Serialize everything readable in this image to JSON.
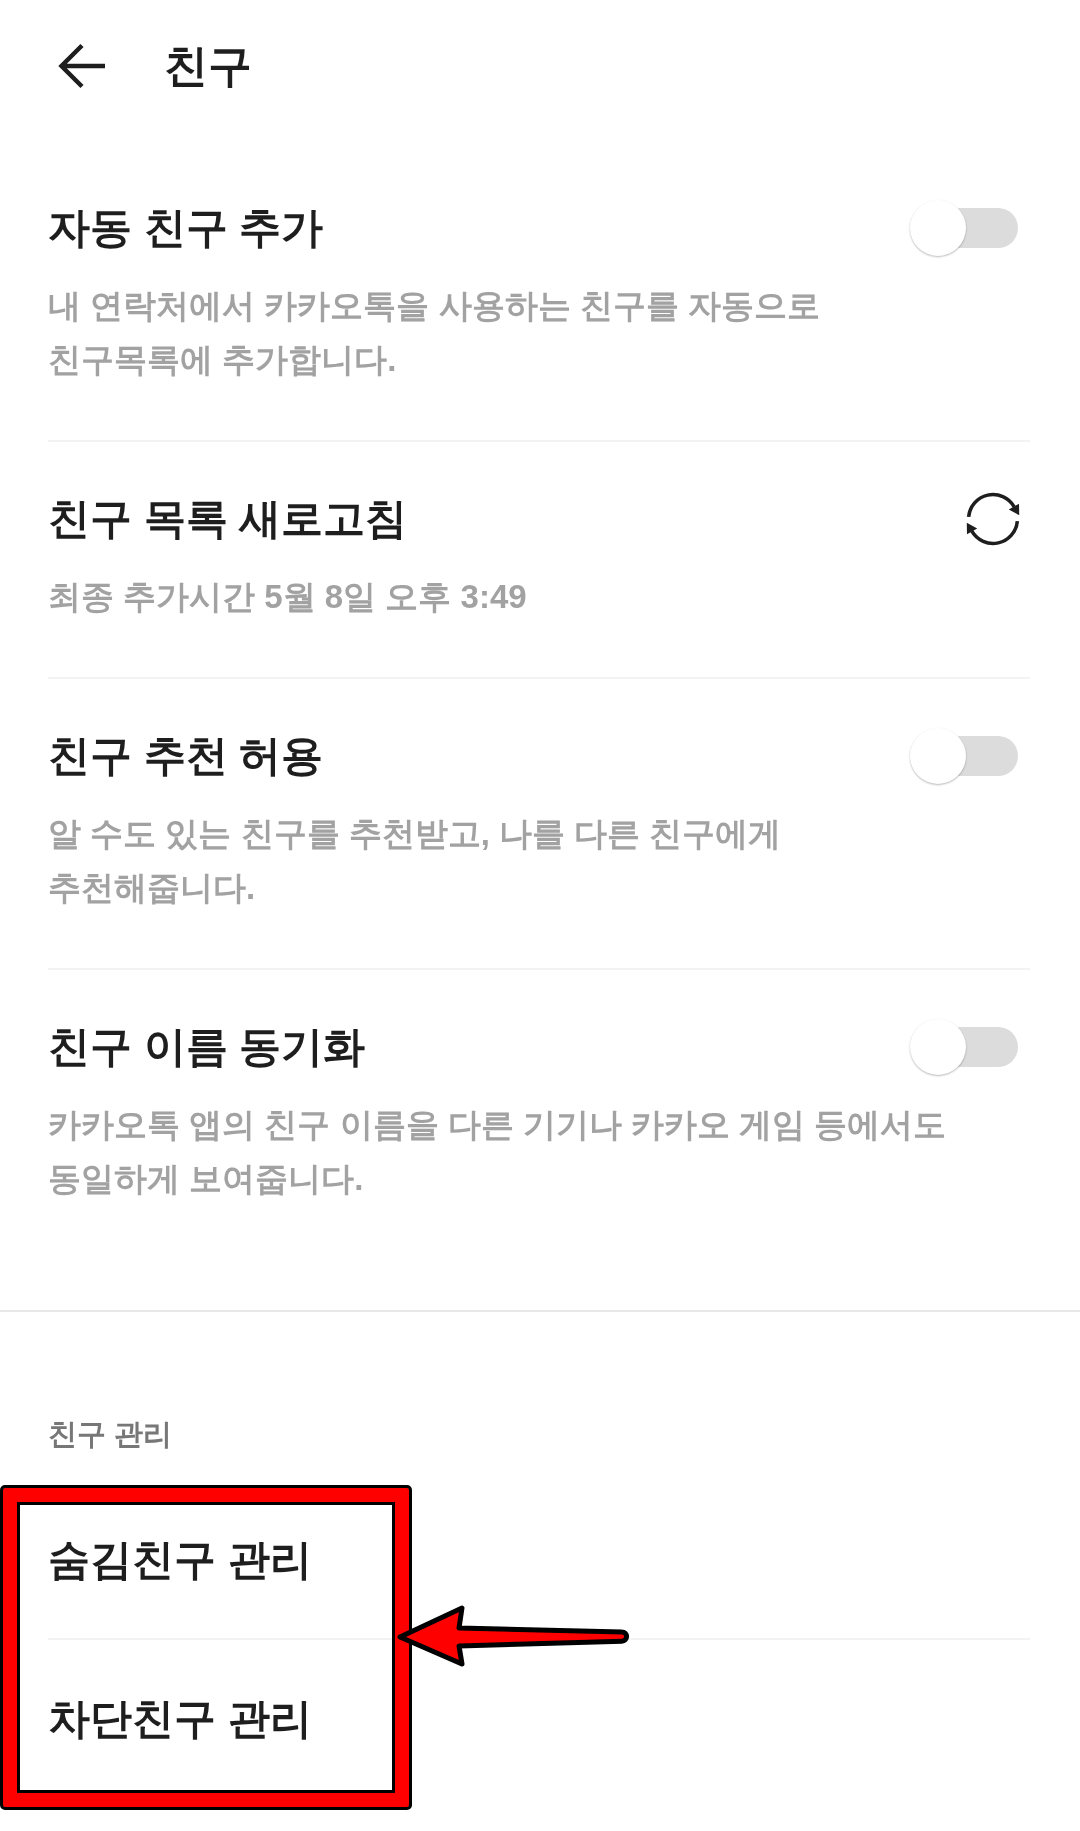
{
  "header": {
    "title": "친구"
  },
  "settings": [
    {
      "kind": "toggle",
      "title": "자동 친구 추가",
      "on": false,
      "description": "내 연락처에서 카카오톡을 사용하는 친구를 자동으로\n친구목록에 추가합니다."
    },
    {
      "kind": "refresh",
      "title": "친구 목록 새로고침",
      "description": "최종 추가시간 5월 8일 오후 3:49"
    },
    {
      "kind": "toggle",
      "title": "친구 추천 허용",
      "on": false,
      "description": "알 수도 있는 친구를 추천받고, 나를 다른 친구에게\n추천해줍니다."
    },
    {
      "kind": "toggle",
      "title": "친구 이름 동기화",
      "on": false,
      "description": "카카오톡 앱의 친구 이름을 다른 기기나 카카오 게임 등에서도\n동일하게 보여줍니다."
    }
  ],
  "manage_section": {
    "heading": "친구 관리",
    "highlighted": true,
    "items": [
      {
        "title": "숨김친구 관리"
      },
      {
        "title": "차단친구 관리"
      }
    ]
  }
}
